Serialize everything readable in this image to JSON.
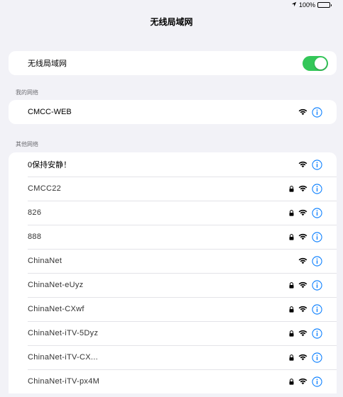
{
  "status_bar": {
    "battery_text": "100%"
  },
  "title": "无线局域网",
  "wifi_toggle": {
    "label": "无线局域网",
    "on": true
  },
  "my_networks": {
    "label": "我的网络",
    "items": [
      {
        "name": "CMCC-WEB",
        "locked": false
      }
    ]
  },
  "other_networks": {
    "label": "其他网络",
    "items": [
      {
        "name": "0保持安静！",
        "locked": false
      },
      {
        "name": "CMCC22",
        "locked": true
      },
      {
        "name": "826",
        "locked": true
      },
      {
        "name": "888",
        "locked": true
      },
      {
        "name": "ChinaNet",
        "locked": false
      },
      {
        "name": "ChinaNet-eUyz",
        "locked": true
      },
      {
        "name": "ChinaNet-CXwf",
        "locked": true
      },
      {
        "name": "ChinaNet-iTV-5Dyz",
        "locked": true
      },
      {
        "name": "ChinaNet-iTV-CX...",
        "locked": true
      },
      {
        "name": "ChinaNet-iTV-px4M",
        "locked": true
      }
    ]
  },
  "colors": {
    "accent": "#007aff",
    "toggle_on": "#34c759",
    "background": "#f2f2f7"
  }
}
